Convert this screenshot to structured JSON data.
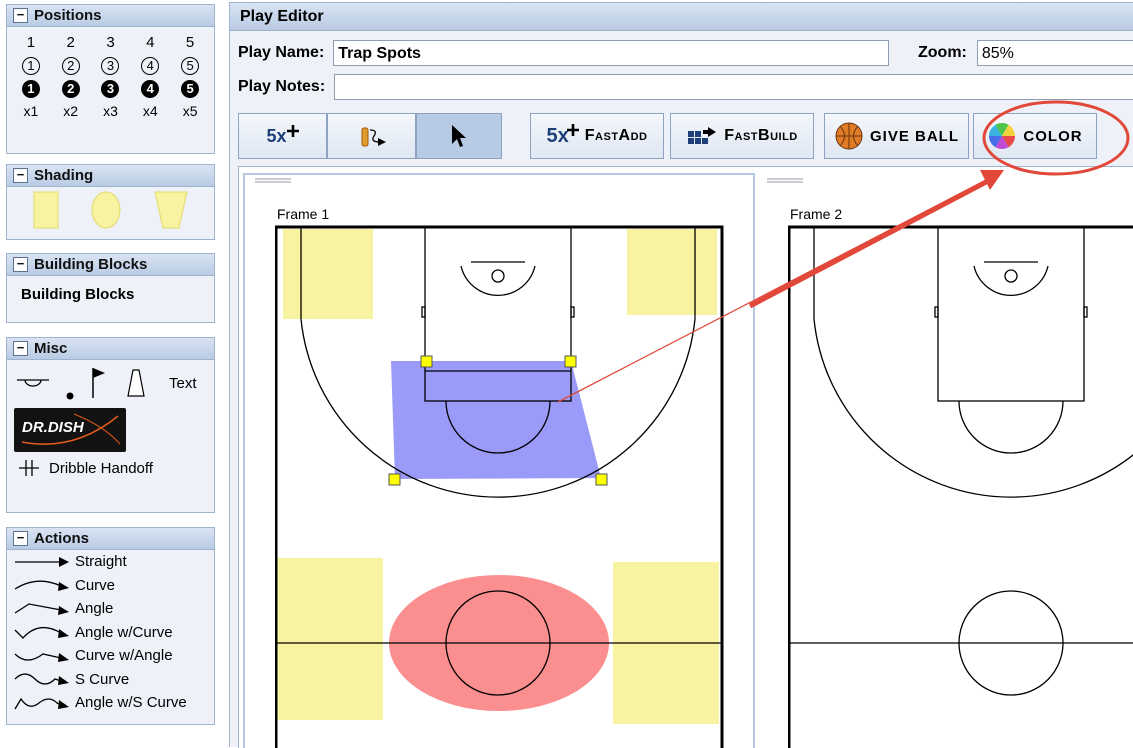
{
  "positions": {
    "title": "Positions",
    "plain": [
      "1",
      "2",
      "3",
      "4",
      "5"
    ],
    "outlined": [
      "1",
      "2",
      "3",
      "4",
      "5"
    ],
    "filled": [
      "1",
      "2",
      "3",
      "4",
      "5"
    ],
    "xlabels": [
      "x1",
      "x2",
      "x3",
      "x4",
      "x5"
    ]
  },
  "shading": {
    "title": "Shading"
  },
  "building_blocks": {
    "title": "Building Blocks",
    "item": "Building Blocks"
  },
  "misc": {
    "title": "Misc",
    "text_label": "Text",
    "logo_text": "DR.DISH",
    "handoff_label": "Dribble Handoff"
  },
  "actions": {
    "title": "Actions",
    "items": [
      "Straight",
      "Curve",
      "Angle",
      "Angle w/Curve",
      "Curve w/Angle",
      "S Curve",
      "Angle w/S Curve"
    ]
  },
  "editor": {
    "title": "Play Editor",
    "play_name_label": "Play Name:",
    "play_name_value": "Trap Spots",
    "zoom_label": "Zoom:",
    "zoom_value": "85%",
    "play_notes_label": "Play Notes:",
    "play_notes_value": ""
  },
  "toolbar": {
    "add5_label": "5x",
    "fastadd_label": "FastAdd",
    "fastbuild_label": "FastBuild",
    "giveball_label": "GIVE BALL",
    "color_label": "COLOR"
  },
  "frames": [
    {
      "label": "Frame 1"
    },
    {
      "label": "Frame 2"
    }
  ],
  "colors": {
    "highlight": "#e1483a",
    "shade_yellow": "#f8f3a0",
    "shade_blue": "#8f8ff7",
    "shade_red": "#fb8f8f"
  }
}
